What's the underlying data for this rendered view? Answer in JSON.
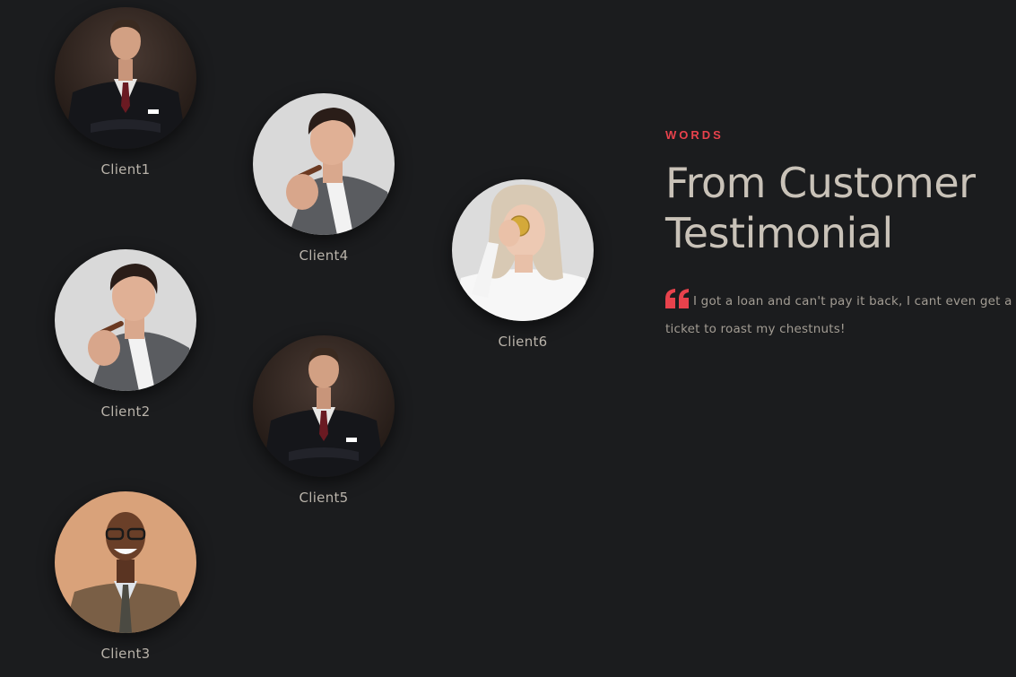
{
  "colors": {
    "background": "#1b1c1e",
    "accent": "#e8424c",
    "heading": "#c9c2b8",
    "body_text": "#a29c93",
    "client_name": "#b9b3aa"
  },
  "clients": [
    {
      "name": "Client1",
      "photo": "man-in-black-suit-arms-crossed"
    },
    {
      "name": "Client2",
      "photo": "man-with-cigar-grey-blazer"
    },
    {
      "name": "Client3",
      "photo": "smiling-man-glasses-tweed-jacket"
    },
    {
      "name": "Client4",
      "photo": "man-with-cigar-grey-blazer"
    },
    {
      "name": "Client5",
      "photo": "man-in-black-suit-arms-crossed"
    },
    {
      "name": "Client6",
      "photo": "blonde-woman-holding-coin"
    }
  ],
  "testimonial": {
    "eyebrow": "WORDS",
    "heading_line1": "From Customer",
    "heading_line2": "Testimonial",
    "quote_icon": "quote-left-icon",
    "quote": "I got a loan and can't pay it back, I cant even get a ticket to roast my chestnuts!"
  }
}
